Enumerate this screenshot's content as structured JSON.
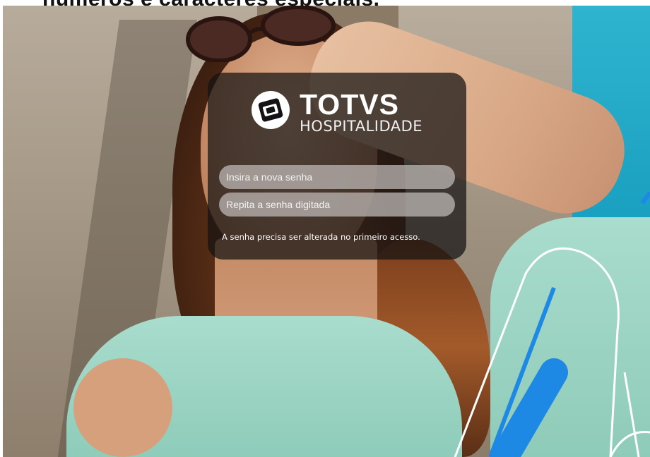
{
  "header": {
    "caption": "números e caracteres especiais."
  },
  "brand": {
    "name": "TOTVS",
    "product": "HOSPITALIDADE"
  },
  "form": {
    "new_password_placeholder": "Insira a nova senha",
    "repeat_password_placeholder": "Repita a senha digitada",
    "notice": "A senha precisa ser alterada no primeiro acesso."
  },
  "colors": {
    "panel_bg": "#141212",
    "field_bg": "#b9b2af",
    "accent_blue": "#1e88e5",
    "deco_white": "#ffffff"
  },
  "icons": [
    "totvs-logo-icon"
  ]
}
